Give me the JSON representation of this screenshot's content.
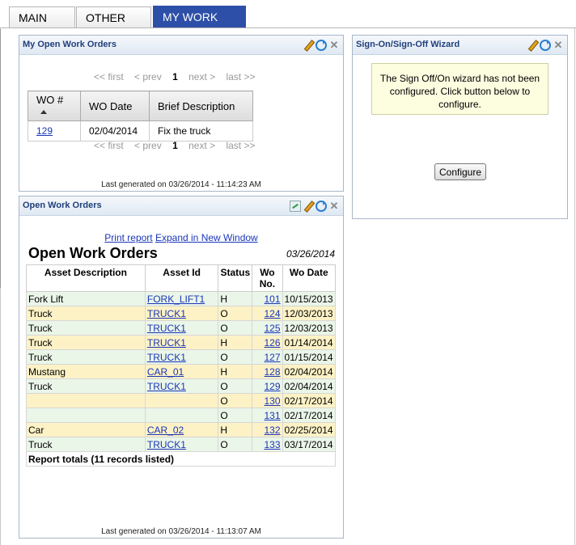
{
  "tabs": [
    {
      "label": "MAIN"
    },
    {
      "label": "OTHER"
    },
    {
      "label": "MY WORK"
    }
  ],
  "my_open_work_orders": {
    "title": "My Open Work Orders",
    "pager": {
      "first": "<< first",
      "prev": "< prev",
      "page": "1",
      "next": "next >",
      "last": "last >>"
    },
    "columns": [
      "WO #",
      "WO Date",
      "Brief Description"
    ],
    "rows": [
      {
        "wo": "129",
        "date": "02/04/2014",
        "desc": "Fix the truck"
      }
    ],
    "footer": "Last generated on 03/26/2014 - 11:14:23 AM"
  },
  "open_work_orders": {
    "title": "Open Work Orders",
    "print_link": "Print report",
    "expand_link": "Expand in New Window",
    "report_title": "Open Work Orders",
    "report_date": "03/26/2014",
    "columns": [
      "Asset Description",
      "Asset Id",
      "Status",
      "Wo No.",
      "Wo Date"
    ],
    "rows": [
      {
        "desc": "Fork Lift",
        "asset_id": "FORK_LIFT1",
        "status": "H",
        "wo": "101",
        "date": "10/15/2013"
      },
      {
        "desc": "Truck",
        "asset_id": "TRUCK1",
        "status": "O",
        "wo": "124",
        "date": "12/03/2013"
      },
      {
        "desc": "Truck",
        "asset_id": "TRUCK1",
        "status": "O",
        "wo": "125",
        "date": "12/03/2013"
      },
      {
        "desc": "Truck",
        "asset_id": "TRUCK1",
        "status": "H",
        "wo": "126",
        "date": "01/14/2014"
      },
      {
        "desc": "Truck",
        "asset_id": "TRUCK1",
        "status": "O",
        "wo": "127",
        "date": "01/15/2014"
      },
      {
        "desc": "Mustang",
        "asset_id": "CAR_01",
        "status": "H",
        "wo": "128",
        "date": "02/04/2014"
      },
      {
        "desc": "Truck",
        "asset_id": "TRUCK1",
        "status": "O",
        "wo": "129",
        "date": "02/04/2014"
      },
      {
        "desc": "",
        "asset_id": "",
        "status": "O",
        "wo": "130",
        "date": "02/17/2014"
      },
      {
        "desc": "",
        "asset_id": "",
        "status": "O",
        "wo": "131",
        "date": "02/17/2014"
      },
      {
        "desc": "Car",
        "asset_id": "CAR_02",
        "status": "H",
        "wo": "132",
        "date": "02/25/2014"
      },
      {
        "desc": "Truck",
        "asset_id": "TRUCK1",
        "status": "O",
        "wo": "133",
        "date": "03/17/2014"
      }
    ],
    "totals": "Report totals (11 records listed)",
    "footer": "Last generated on 03/26/2014 - 11:13:07 AM"
  },
  "wizard": {
    "title": "Sign-On/Sign-Off Wizard",
    "message": "The Sign Off/On wizard has not been configured. Click button below to configure.",
    "button": "Configure"
  },
  "colors": {
    "active_tab": "#2e4fa8",
    "link": "#1a36b8",
    "row_green": "#eaf6e8",
    "row_yellow": "#fdf2c6"
  }
}
